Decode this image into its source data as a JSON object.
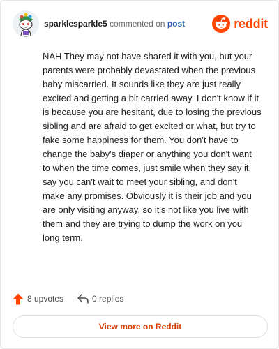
{
  "comment": {
    "username": "sparklesparkle5",
    "action_text": "commented on",
    "post_link": "post",
    "body": "NAH They may not have shared it with you, but your parents were probably devastated when the previous baby miscarried. It sounds like they are just really excited and getting a bit carried away. I don't know if it is because you are hesitant, due to losing the previous sibling and are afraid to get excited or what, but try to fake some happiness for them. You don't have to change the baby's diaper or anything you don't want to when the time comes, just smile when they say it, say you can't wait to meet your sibling, and don't make any promises. Obviously it is their job and you are only visiting anyway, so it's not like you live with them and they are trying to dump the work on you long term."
  },
  "brand": {
    "wordmark": "reddit",
    "color": "#ff4500"
  },
  "actions": {
    "upvotes": "8 upvotes",
    "replies": "0 replies"
  },
  "footer": {
    "view_more_label": "View more on Reddit"
  },
  "icons": {
    "avatar": "snoo-avatar-icon",
    "logo": "reddit-logo-icon",
    "upvote": "upvote-arrow-icon",
    "reply": "reply-arrow-icon"
  }
}
